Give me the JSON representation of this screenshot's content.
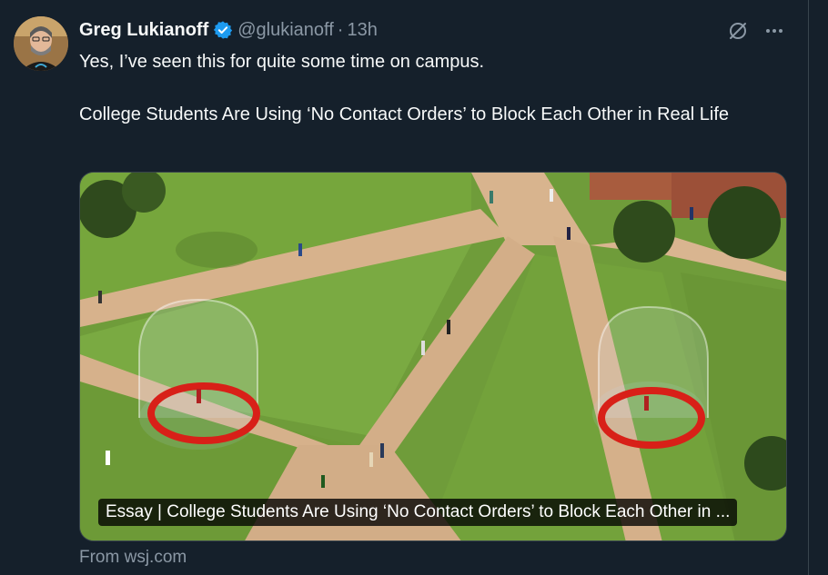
{
  "author": {
    "name": "Greg Lukianoff",
    "handle": "@glukianoff",
    "time": "13h",
    "verified": true
  },
  "tweet": {
    "line1": "Yes, I’ve seen this for quite some time on campus.",
    "line2": "College Students Are Using ‘No Contact Orders’ to Block Each Other in Real Life"
  },
  "link_card": {
    "caption": "Essay | College Students Are Using ‘No Contact Orders’ to Block Each Other in ...",
    "source": "From wsj.com"
  },
  "icons": [
    "verified-badge-icon",
    "grok-icon",
    "more-icon"
  ],
  "colors": {
    "background": "#15202b",
    "text": "#f7f9f9",
    "muted": "#8b98a5",
    "verified": "#1d9bf0"
  }
}
